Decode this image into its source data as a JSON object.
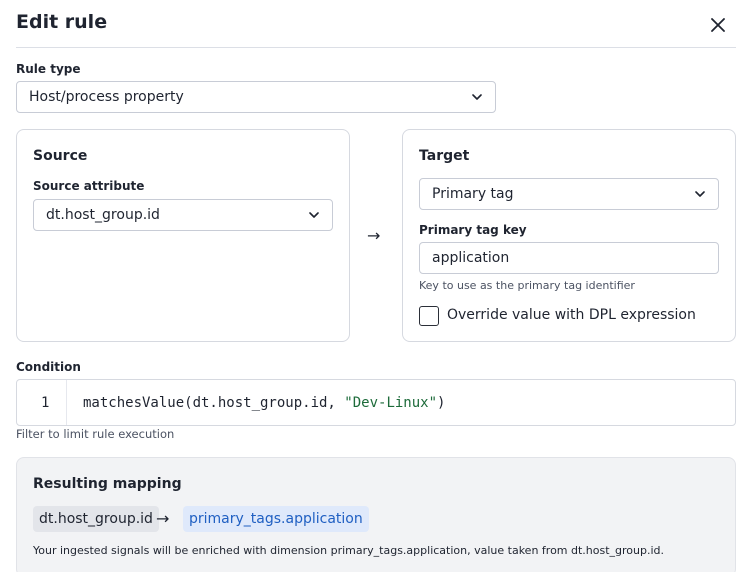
{
  "dialog": {
    "title": "Edit rule",
    "close_icon": "close-icon"
  },
  "rule_type": {
    "label": "Rule type",
    "value": "Host/process property"
  },
  "source": {
    "title": "Source",
    "attribute_label": "Source attribute",
    "attribute_value": "dt.host_group.id"
  },
  "mapping_arrow": "→",
  "target": {
    "title": "Target",
    "type_value": "Primary tag",
    "key_label": "Primary tag key",
    "key_value": "application",
    "key_hint": "Key to use as the primary tag identifier",
    "override_label": "Override value with DPL expression",
    "override_checked": false
  },
  "condition": {
    "label": "Condition",
    "line_number": "1",
    "code_prefix": "matchesValue(dt.host_group.id, ",
    "code_string": "\"Dev-Linux\"",
    "code_suffix": ")",
    "hint": "Filter to limit rule execution"
  },
  "resulting_mapping": {
    "title": "Resulting mapping",
    "source_chip": "dt.host_group.id",
    "arrow": "→",
    "target_chip": "primary_tags.application",
    "description": "Your ingested signals will be enriched with dimension primary_tags.application, value taken from dt.host_group.id."
  },
  "colors": {
    "accent": "#1f5fc2",
    "chip_target_bg": "#dfe9fb",
    "panel_bg": "#f2f3f5",
    "code_string": "#1d6b3a"
  }
}
